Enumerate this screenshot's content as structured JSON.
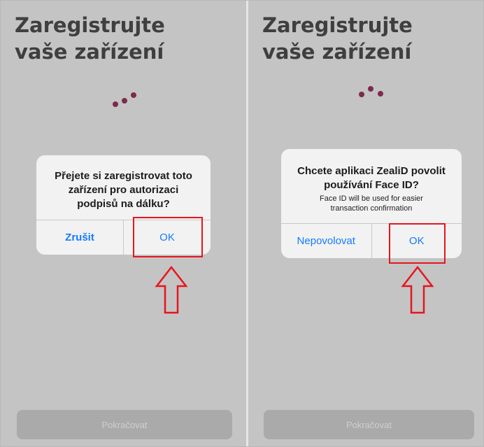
{
  "left_screen": {
    "title_line1": "Zaregistrujte",
    "title_line2": "vaše zařízení",
    "dialog": {
      "message_line1": "Přejete si zaregistrovat toto",
      "message_line2": "zařízení pro autorizaci",
      "message_line3": "podpisů na dálku?",
      "cancel_label": "Zrušit",
      "ok_label": "OK"
    },
    "continue_label": "Pokračovat"
  },
  "right_screen": {
    "title_line1": "Zaregistrujte",
    "title_line2": "vaše zařízení",
    "dialog": {
      "message_line1": "Chcete aplikaci ZealiD povolit",
      "message_line2": "používání Face ID?",
      "detail_line1": "Face ID will be used for easier",
      "detail_line2": "transaction confirmation",
      "deny_label": "Nepovolovat",
      "ok_label": "OK"
    },
    "continue_label": "Pokračovat"
  },
  "colors": {
    "screen_bg": "#c4c4c4",
    "title_text": "#3f3f3f",
    "loading_dots": "#7c2a4d",
    "dialog_bg": "#f2f2f2",
    "ios_blue": "#147aff",
    "highlight_red": "#e8141e",
    "disabled_button": "#aaaaaa"
  },
  "icons": [
    "loading-dots-icon",
    "up-arrow-icon"
  ]
}
